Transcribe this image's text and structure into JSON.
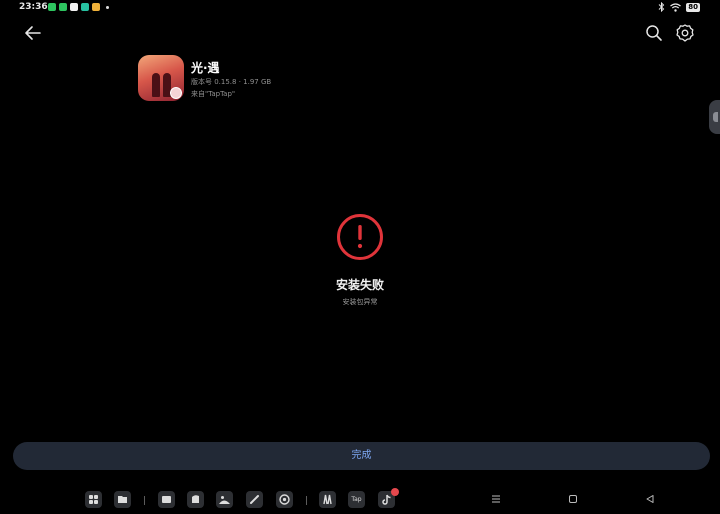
{
  "status_bar": {
    "time": "23:36",
    "battery": "80",
    "notification_icons": [
      "wechat-icon",
      "wechat-icon",
      "app-icon",
      "app-icon",
      "app-icon"
    ],
    "notification_colors": [
      "#2ec45f",
      "#2ec45f",
      "#f2f2f2",
      "#27c0a0",
      "#f0b13a"
    ]
  },
  "header": {
    "back_icon": "arrow-left-icon",
    "search_icon": "search-icon",
    "settings_icon": "gear-icon"
  },
  "app": {
    "name": "光·遇",
    "meta": "版本号 0.15.8 · 1.97 GB",
    "source": "来自\"TapTap\""
  },
  "result": {
    "icon": "error-icon",
    "title": "安装失败",
    "subtitle": "安装包异常",
    "accent_color": "#e0343a"
  },
  "done_button": {
    "label": "完成",
    "color": "#7ea7f2"
  },
  "dock": {
    "items": [
      "grid-icon",
      "file-manager-icon",
      "files-icon",
      "notes-icon",
      "gallery-icon",
      "pen-icon",
      "settings-icon",
      "game-icon",
      "taptap-icon",
      "tiktok-icon"
    ],
    "taptap_label": "Tap",
    "nav": [
      "menu-icon",
      "home-icon",
      "back-triangle-icon"
    ]
  }
}
